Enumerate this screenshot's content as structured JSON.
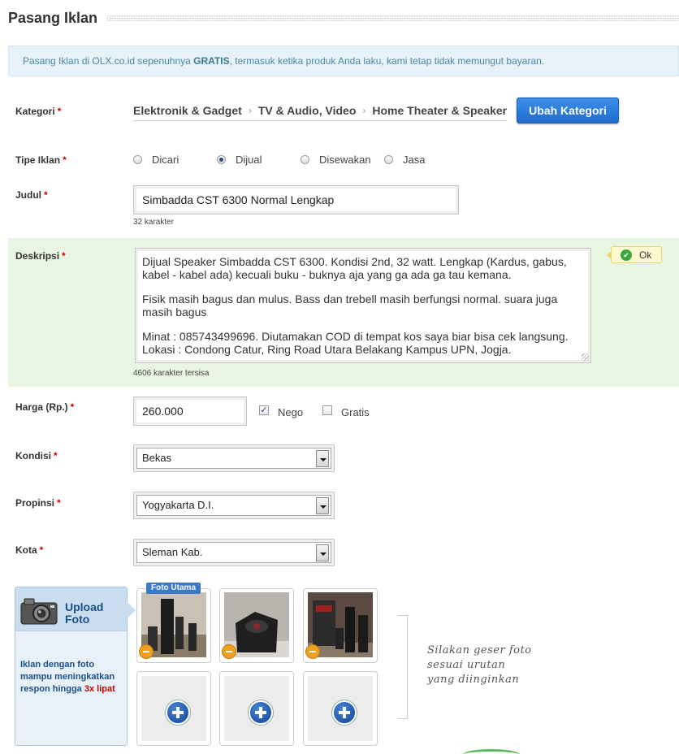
{
  "page": {
    "title": "Pasang Iklan"
  },
  "notice": {
    "prefix": "Pasang Iklan di OLX.co.id sepenuhnya ",
    "highlight": "GRATIS",
    "suffix": ", termasuk ketika produk Anda laku, kami tetap tidak memungut bayaran."
  },
  "form": {
    "required_mark": "*",
    "kategori": {
      "label": "Kategori",
      "crumbs": [
        "Elektronik & Gadget",
        "TV & Audio, Video",
        "Home Theater & Speaker"
      ],
      "change_button": "Ubah Kategori"
    },
    "tipe_iklan": {
      "label": "Tipe Iklan",
      "options": [
        "Dicari",
        "Dijual",
        "Disewakan",
        "Jasa"
      ],
      "selected": "Dijual"
    },
    "judul": {
      "label": "Judul",
      "value": "Simbadda CST 6300 Normal Lengkap",
      "counter": "32 karakter"
    },
    "deskripsi": {
      "label": "Deskripsi",
      "paragraphs": [
        "Dijual Speaker Simbadda CST 6300. Kondisi 2nd, 32 watt. Lengkap (Kardus, gabus, kabel - kabel ada) kecuali buku - buknya aja yang ga ada ga tau kemana.",
        "Fisik masih bagus dan mulus. Bass dan trebell masih berfungsi normal. suara juga masih bagus",
        "Minat : 085743499696. Diutamakan COD di tempat kos saya biar bisa cek langsung. Lokasi : Condong Catur, Ring Road Utara Belakang Kampus UPN, Jogja."
      ],
      "counter": "4606 karakter tersisa",
      "status": "Ok"
    },
    "harga": {
      "label": "Harga (Rp.)",
      "value": "260.000",
      "nego_label": "Nego",
      "nego_checked": true,
      "gratis_label": "Gratis",
      "gratis_checked": false
    },
    "kondisi": {
      "label": "Kondisi",
      "value": "Bekas"
    },
    "propinsi": {
      "label": "Propinsi",
      "value": "Yogyakarta D.I."
    },
    "kota": {
      "label": "Kota",
      "value": "Sleman Kab."
    }
  },
  "upload": {
    "title_line1": "Upload",
    "title_line2": "Foto",
    "note": "Iklan dengan foto mampu meningkatkan respon hingga ",
    "note_highlight": "3x lipat",
    "main_tag": "Foto Utama",
    "hint_lines": [
      "Silakan geser foto",
      "sesuai urutan",
      "yang diinginkan"
    ],
    "photos_filled": 3,
    "slots_empty": 3
  },
  "colors": {
    "accent_blue": "#1f6ccd",
    "required_red": "#cc0000",
    "desc_bg": "#e8f5e1",
    "notice_bg": "#e6f2f7"
  }
}
